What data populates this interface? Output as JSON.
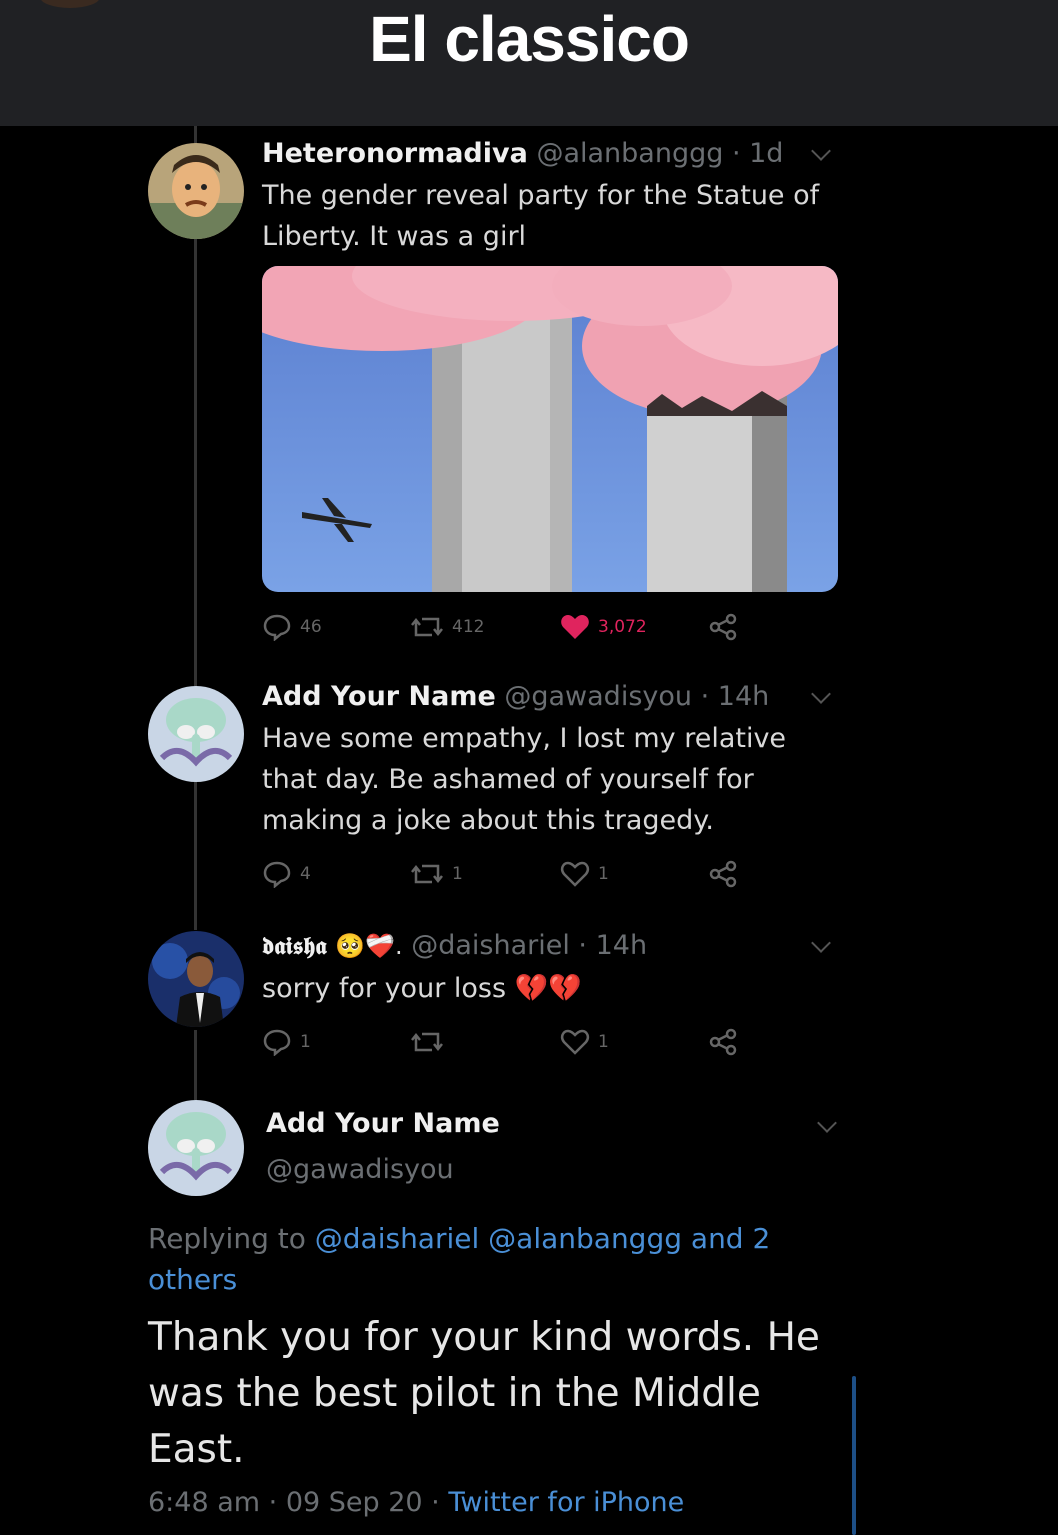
{
  "header": {
    "title": "El classico"
  },
  "tweets": [
    {
      "name": "Heteronormadiva",
      "handle": "@alanbanggg",
      "time": "· 1d",
      "text": "The gender reveal party for the Statue of Liberty. It was a girl",
      "counts": {
        "replies": "46",
        "retweets": "412",
        "likes": "3,072"
      },
      "liked": true
    },
    {
      "name": "Add Your Name",
      "handle": "@gawadisyou",
      "time": "· 14h",
      "text": "Have some empathy, I lost my relative that day. Be ashamed of yourself for making a joke about this tragedy.",
      "counts": {
        "replies": "4",
        "retweets": "1",
        "likes": "1"
      },
      "liked": false
    },
    {
      "name": "𝖉𝖆𝖎𝖘𝖍𝖆",
      "name_emojis": "🥺❤️‍🩹.",
      "handle": "@daishariel",
      "time": "· 14h",
      "text": "sorry for your loss",
      "text_emojis": "💔💔",
      "counts": {
        "replies": "1",
        "retweets": "",
        "likes": "1"
      },
      "liked": false
    }
  ],
  "focus_tweet": {
    "name": "Add Your Name",
    "handle": "@gawadisyou",
    "replying_prefix": "Replying to",
    "replying_links": "@daishariel @alanbanggg and 2",
    "replying_links_2": "others",
    "text": "Thank you for your kind words. He was the best pilot in the Middle East.",
    "time": "6:48 am",
    "date": "· 09 Sep 20 ·",
    "source": "Twitter for iPhone"
  },
  "colors": {
    "like": "#e0245e",
    "link": "#4a8fd6",
    "header_bg": "#202124"
  }
}
